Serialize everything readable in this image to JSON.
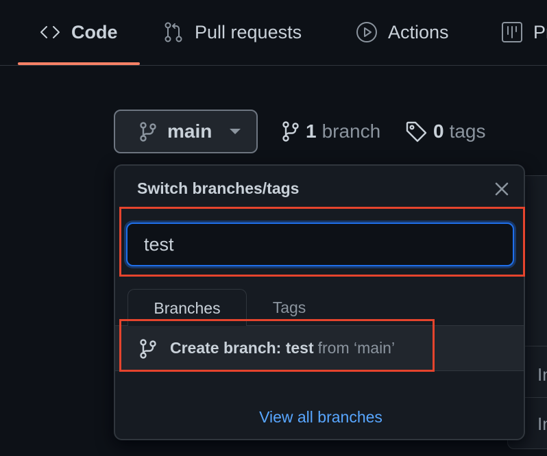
{
  "repo_nav": {
    "tabs": [
      {
        "label": "Code",
        "icon": "code-icon",
        "active": true
      },
      {
        "label": "Pull requests",
        "icon": "pull-request-icon",
        "active": false
      },
      {
        "label": "Actions",
        "icon": "play-icon",
        "active": false
      },
      {
        "label": "Pr",
        "icon": "project-icon",
        "active": false
      }
    ]
  },
  "branch_bar": {
    "current_branch": "main",
    "branch_count": "1",
    "branch_label": "branch",
    "tag_count": "0",
    "tag_label": "tags"
  },
  "popover": {
    "title": "Switch branches/tags",
    "filter_value": "test",
    "tabs": [
      "Branches",
      "Tags"
    ],
    "create_prefix": "Create branch: test",
    "create_suffix": "from ‘main’",
    "view_all": "View all branches"
  },
  "background_text": [
    "In",
    "In"
  ],
  "colors": {
    "accent_underline": "#f78166",
    "link": "#58a6ff",
    "focus": "#1f6feb",
    "highlight_box": "#e5442d"
  }
}
